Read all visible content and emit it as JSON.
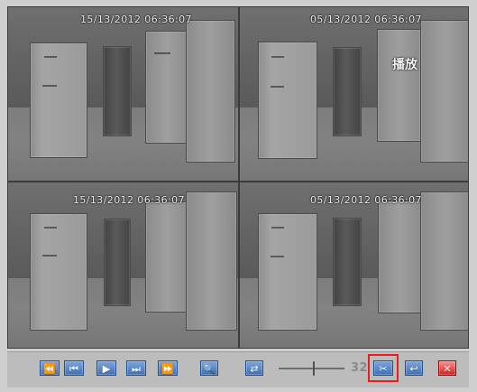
{
  "viewer": {
    "tiles": [
      {
        "timestamp": "15/13/2012 06:36:07"
      },
      {
        "timestamp": "05/13/2012 06:36:07",
        "play_label": "播放"
      },
      {
        "timestamp": "15/13/2012 06:36:07"
      },
      {
        "timestamp": "05/13/2012 06:36:07"
      }
    ]
  },
  "toolbar": {
    "value": "32",
    "icons": {
      "rewind": "rewind-icon",
      "step_back": "step-back-icon",
      "play": "play-icon",
      "step_forward": "step-forward-icon",
      "fast_forward": "fast-forward-icon",
      "zoom": "zoom-icon",
      "mode": "mode-icon",
      "cut": "cut-icon",
      "back": "back-icon",
      "close": "close-icon"
    }
  }
}
